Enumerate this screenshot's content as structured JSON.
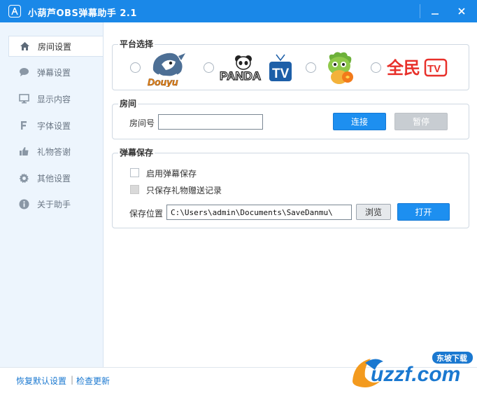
{
  "window": {
    "title": "小葫芦OBS弹幕助手 2.1",
    "minimize_glyph": "—",
    "close_glyph": "X"
  },
  "sidebar": {
    "items": [
      {
        "label": "房间设置",
        "icon": "home-icon",
        "active": true
      },
      {
        "label": "弹幕设置",
        "icon": "chat-bubble-icon",
        "active": false
      },
      {
        "label": "显示内容",
        "icon": "monitor-icon",
        "active": false
      },
      {
        "label": "字体设置",
        "icon": "font-icon",
        "active": false
      },
      {
        "label": "礼物答谢",
        "icon": "thumbs-up-icon",
        "active": false
      },
      {
        "label": "其他设置",
        "icon": "gear-icon",
        "active": false
      },
      {
        "label": "关于助手",
        "icon": "info-icon",
        "active": false
      }
    ]
  },
  "platform": {
    "title": "平台选择",
    "logos": {
      "douyu": "Douyu",
      "panda": "PANDA",
      "panda_tv": "TV",
      "quanmin": "全民",
      "quanmin_tv": "TV"
    }
  },
  "room": {
    "title": "房间",
    "room_label": "房间号",
    "room_value": "",
    "connect_label": "连接",
    "pause_label": "暂停"
  },
  "save": {
    "title": "弹幕保存",
    "enable_label": "启用弹幕保存",
    "gift_only_label": "只保存礼物赠送记录",
    "path_label": "保存位置",
    "path_value": "C:\\Users\\admin\\Documents\\SaveDanmu\\",
    "browse_label": "浏览",
    "open_label": "打开"
  },
  "footer": {
    "reset_label": "恢复默认设置",
    "separator": "|",
    "update_label": "检查更新"
  },
  "watermark": {
    "text": "uzzf.com",
    "badge": "东坡下载"
  },
  "colors": {
    "accent": "#1a88e8",
    "sidebar_bg": "#edf5fd",
    "douyu_orange": "#f08a1a",
    "panda_blue": "#1d5fa8",
    "quanmin_red": "#e8302a",
    "dragon_green": "#6db13a"
  }
}
